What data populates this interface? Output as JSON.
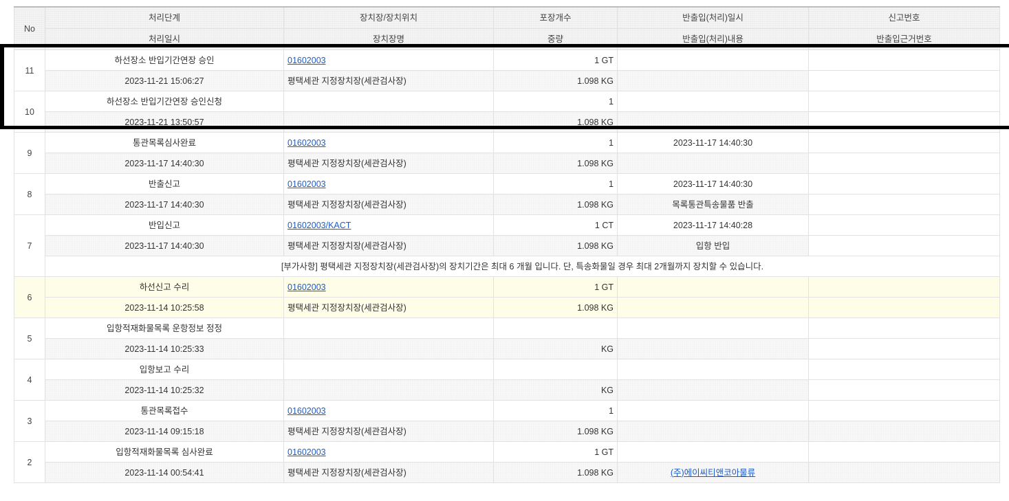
{
  "header": {
    "no": "No",
    "row1": [
      "처리단계",
      "장치장/장치위치",
      "포장개수",
      "반출입(처리)일시",
      "신고번호"
    ],
    "row2": [
      "처리일시",
      "장치장명",
      "중량",
      "반출입(처리)내용",
      "반출입근거번호"
    ]
  },
  "rows": [
    {
      "no": "11",
      "stage": "하선장소 반입기간연장 승인",
      "datetime": "2023-11-21 15:06:27",
      "location": "01602003",
      "location_link": true,
      "warehouse": "평택세관 지정장치장(세관검사장)",
      "pkg": "1 GT",
      "weight": "1.098 KG",
      "io_dt": "",
      "io_content": "",
      "blank_last": true
    },
    {
      "no": "10",
      "stage": "하선장소 반입기간연장 승인신청",
      "datetime": "2023-11-21 13:50:57",
      "location": "",
      "location_link": false,
      "warehouse": "",
      "pkg": "1",
      "weight": "1.098 KG",
      "io_dt": "",
      "io_content": "",
      "blank_last": true
    },
    {
      "no": "9",
      "stage": "통관목록심사완료",
      "datetime": "2023-11-17 14:40:30",
      "location": "01602003",
      "location_link": true,
      "warehouse": "평택세관 지정장치장(세관검사장)",
      "pkg": "1",
      "weight": "1.098 KG",
      "io_dt": "2023-11-17 14:40:30",
      "io_content": "",
      "blank_last": true
    },
    {
      "no": "8",
      "stage": "반출신고",
      "datetime": "2023-11-17 14:40:30",
      "location": "01602003",
      "location_link": true,
      "warehouse": "평택세관 지정장치장(세관검사장)",
      "pkg": "1",
      "weight": "1.098 KG",
      "io_dt": "2023-11-17 14:40:30",
      "io_content": "목록통관특송물품 반출",
      "blank_last": true
    },
    {
      "no": "7",
      "stage": "반입신고",
      "datetime": "2023-11-17 14:40:30",
      "location": "01602003/KACT",
      "location_link": true,
      "warehouse": "평택세관 지정장치장(세관검사장)",
      "pkg": "1 CT",
      "weight": "1.098 KG",
      "io_dt": "2023-11-17 14:40:28",
      "io_content": "입항 반입",
      "blank_last": true,
      "note": "[부가사항] 평택세관 지정장치장(세관검사장)의 장치기간은 최대 6 개월 입니다. 단, 특송화물일 경우 최대 2개월까지 장치할 수 있습니다."
    },
    {
      "no": "6",
      "stage": "하선신고 수리",
      "datetime": "2023-11-14 10:25:58",
      "location": "01602003",
      "location_link": true,
      "warehouse": "평택세관 지정장치장(세관검사장)",
      "pkg": "1 GT",
      "weight": "1.098 KG",
      "io_dt": "",
      "io_content": "",
      "blank_last": false,
      "highlight": true
    },
    {
      "no": "5",
      "stage": "입항적재화물목록 운항정보 정정",
      "datetime": "2023-11-14 10:25:33",
      "location": "",
      "location_link": false,
      "warehouse": "",
      "pkg": "",
      "weight": "KG",
      "io_dt": "",
      "io_content": "",
      "blank_last": true
    },
    {
      "no": "4",
      "stage": "입항보고 수리",
      "datetime": "2023-11-14 10:25:32",
      "location": "",
      "location_link": false,
      "warehouse": "",
      "pkg": "",
      "weight": "KG",
      "io_dt": "",
      "io_content": "",
      "blank_last": true
    },
    {
      "no": "3",
      "stage": "통관목록접수",
      "datetime": "2023-11-14 09:15:18",
      "location": "01602003",
      "location_link": true,
      "warehouse": "평택세관 지정장치장(세관검사장)",
      "pkg": "1",
      "weight": "1.098 KG",
      "io_dt": "",
      "io_content": "",
      "blank_last": false
    },
    {
      "no": "2",
      "stage": "입항적재화물목록 심사완료",
      "datetime": "2023-11-14 00:54:41",
      "location": "01602003",
      "location_link": true,
      "warehouse": "평택세관 지정장치장(세관검사장)",
      "pkg": "1 GT",
      "weight": "1.098 KG",
      "io_dt": "",
      "io_content": "(주)에이씨티앤코아물류",
      "io_content_link": true,
      "blank_last": false
    }
  ]
}
